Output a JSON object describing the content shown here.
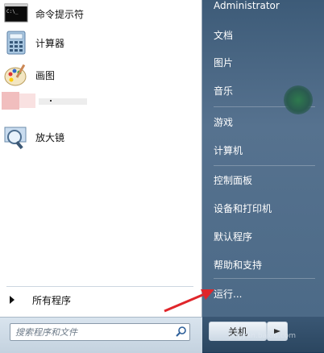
{
  "left": {
    "programs": [
      {
        "label": "命令提示符",
        "icon": "cmd-icon"
      },
      {
        "label": "计算器",
        "icon": "calculator-icon"
      },
      {
        "label": "画图",
        "icon": "paint-icon"
      },
      {
        "label": "",
        "icon": "blurred-program-icon"
      },
      {
        "label": "放大镜",
        "icon": "magnifier-icon"
      }
    ],
    "all_programs": "所有程序",
    "search_placeholder": "搜索程序和文件"
  },
  "right": {
    "user": "Administrator",
    "items": [
      "文档",
      "图片",
      "音乐",
      "游戏",
      "计算机",
      "控制面板",
      "设备和打印机",
      "默认程序",
      "帮助和支持",
      "运行..."
    ],
    "shutdown": "关机"
  },
  "watermark": "jingyan.baidu.com",
  "colors": {
    "arrow": "#e0262b",
    "right_pane": "#4c6a87"
  }
}
